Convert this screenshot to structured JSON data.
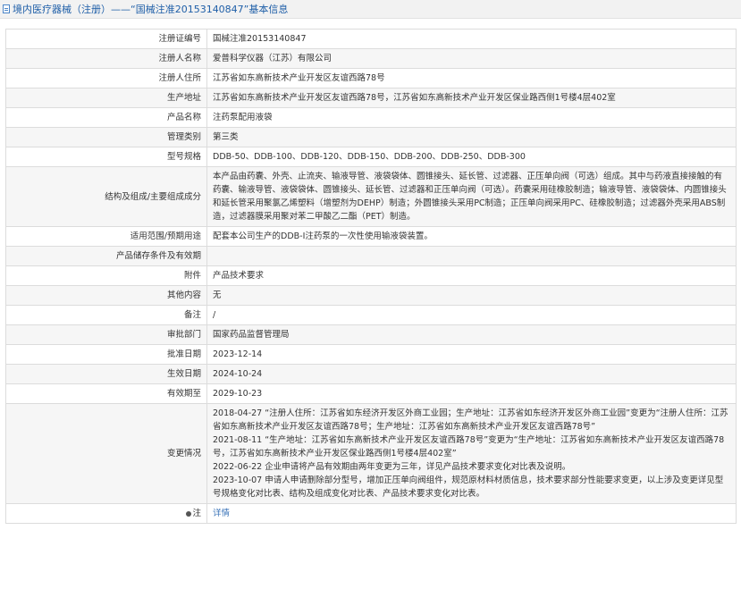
{
  "header": {
    "title": "境内医疗器械（注册）——“国械注准20153140847”基本信息"
  },
  "rows": [
    {
      "label": "注册证编号",
      "value": "国械注准20153140847"
    },
    {
      "label": "注册人名称",
      "value": "爱普科学仪器（江苏）有限公司"
    },
    {
      "label": "注册人住所",
      "value": "江苏省如东高新技术产业开发区友谊西路78号"
    },
    {
      "label": "生产地址",
      "value": "江苏省如东高新技术产业开发区友谊西路78号，江苏省如东高新技术产业开发区保业路西侧1号楼4层402室"
    },
    {
      "label": "产品名称",
      "value": "注药泵配用液袋"
    },
    {
      "label": "管理类别",
      "value": "第三类"
    },
    {
      "label": "型号规格",
      "value": "DDB-50、DDB-100、DDB-120、DDB-150、DDB-200、DDB-250、DDB-300"
    },
    {
      "label": "结构及组成/主要组成成分",
      "value": "本产品由药囊、外壳、止流夹、输液导管、液袋袋体、圆锥接头、延长管、过滤器、正压单向阀（可选）组成。其中与药液直接接触的有药囊、输液导管、液袋袋体、圆锥接头、延长管、过滤器和正压单向阀（可选）。药囊采用硅橡胶制造；输液导管、液袋袋体、内圆锥接头和延长管采用聚氯乙烯塑料（增塑剂为DEHP）制造；外圆锥接头采用PC制造；正压单向阀采用PC、硅橡胶制造；过滤器外壳采用ABS制造，过滤器膜采用聚对苯二甲酸乙二酯（PET）制造。"
    },
    {
      "label": "适用范围/预期用途",
      "value": "配套本公司生产的DDB-Ⅰ注药泵的一次性使用输液袋装置。"
    },
    {
      "label": "产品储存条件及有效期",
      "value": ""
    },
    {
      "label": "附件",
      "value": "产品技术要求"
    },
    {
      "label": "其他内容",
      "value": "无"
    },
    {
      "label": "备注",
      "value": "/"
    },
    {
      "label": "审批部门",
      "value": "国家药品监督管理局"
    },
    {
      "label": "批准日期",
      "value": "2023-12-14"
    },
    {
      "label": "生效日期",
      "value": "2024-10-24"
    },
    {
      "label": "有效期至",
      "value": "2029-10-23"
    }
  ],
  "changes": {
    "label": "变更情况",
    "items": [
      "2018-04-27 “注册人住所：江苏省如东经济开发区外商工业园；生产地址：江苏省如东经济开发区外商工业园”变更为“注册人住所：江苏省如东高新技术产业开发区友谊西路78号；生产地址：江苏省如东高新技术产业开发区友谊西路78号”",
      "2021-08-11 “生产地址：江苏省如东高新技术产业开发区友谊西路78号”变更为“生产地址：江苏省如东高新技术产业开发区友谊西路78号，江苏省如东高新技术产业开发区保业路西侧1号楼4层402室”",
      "2022-06-22 企业申请将产品有效期由两年变更为三年，详见产品技术要求变化对比表及说明。",
      "2023-10-07 申请人申请删除部分型号，增加正压单向阀组件，规范原材料材质信息，技术要求部分性能要求变更，以上涉及变更详见型号规格变化对比表、结构及组成变化对比表、产品技术要求变化对比表。"
    ]
  },
  "note": {
    "label": "注",
    "icon": "note-icon",
    "link_text": "详情"
  }
}
